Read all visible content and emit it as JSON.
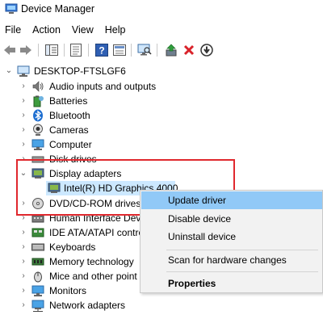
{
  "window": {
    "title": "Device Manager"
  },
  "menu": {
    "items": [
      "File",
      "Action",
      "View",
      "Help"
    ]
  },
  "toolbar": {
    "buttons": [
      "back-icon",
      "forward-icon",
      "show-hide-tree-icon",
      "properties-icon",
      "help-icon",
      "scan-hardware-icon",
      "update-driver-icon",
      "uninstall-icon",
      "disable-icon"
    ]
  },
  "tree": {
    "root": "DESKTOP-FTSLGF6",
    "categories": [
      "Audio inputs and outputs",
      "Batteries",
      "Bluetooth",
      "Cameras",
      "Computer",
      "Disk drives",
      "Display adapters",
      "DVD/CD-ROM drives",
      "Human Interface Dev",
      "IDE ATA/ATAPI contro",
      "Keyboards",
      "Memory technology",
      "Mice and other point",
      "Monitors",
      "Network adapters"
    ],
    "display_child": "Intel(R) HD Graphics 4000"
  },
  "context_menu": {
    "items": [
      "Update driver",
      "Disable device",
      "Uninstall device",
      "Scan for hardware changes",
      "Properties"
    ]
  },
  "colors": {
    "highlight_box": "#e0282e",
    "menu_hover": "#91c9f7",
    "selection": "#cce8ff"
  }
}
